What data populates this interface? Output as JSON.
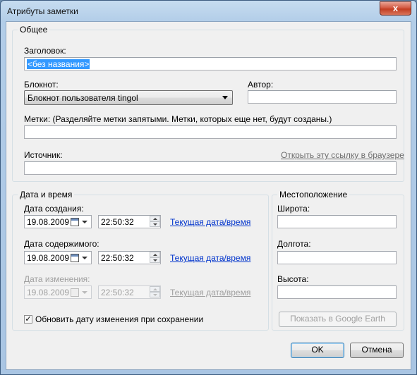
{
  "window": {
    "title": "Атрибуты заметки",
    "close_glyph": "x"
  },
  "general": {
    "legend": "Общее",
    "title_label": "Заголовок:",
    "title_value": "<без названия>",
    "notebook_label": "Блокнот:",
    "notebook_value": "Блокнот пользователя tingol",
    "author_label": "Автор:",
    "author_value": "",
    "tags_label": "Метки: (Разделяйте метки запятыми. Метки, которых еще нет, будут созданы.)",
    "tags_value": "",
    "source_label": "Источник:",
    "source_link": "Открыть эту ссылку в браузере",
    "source_value": ""
  },
  "datetime": {
    "legend": "Дата и время",
    "created_label": "Дата создания:",
    "created_date": "19.08.2009",
    "created_time": "22:50:32",
    "created_link": "Текущая дата/время",
    "content_label": "Дата содержимого:",
    "content_date": "19.08.2009",
    "content_time": "22:50:32",
    "content_link": "Текущая дата/время",
    "modified_label": "Дата изменения:",
    "modified_date": "19.08.2009",
    "modified_time": "22:50:32",
    "modified_link": "Текущая дата/время",
    "update_checkbox_label": "Обновить дату изменения при сохранении",
    "update_checked": true
  },
  "location": {
    "legend": "Местоположение",
    "latitude_label": "Широта:",
    "latitude_value": "",
    "longitude_label": "Долгота:",
    "longitude_value": "",
    "altitude_label": "Высота:",
    "altitude_value": "",
    "google_earth_button": "Показать в Google Earth"
  },
  "buttons": {
    "ok": "OK",
    "cancel": "Отмена"
  },
  "colors": {
    "link": "#0033cc",
    "selection": "#3399ff",
    "close": "#c23e22"
  }
}
